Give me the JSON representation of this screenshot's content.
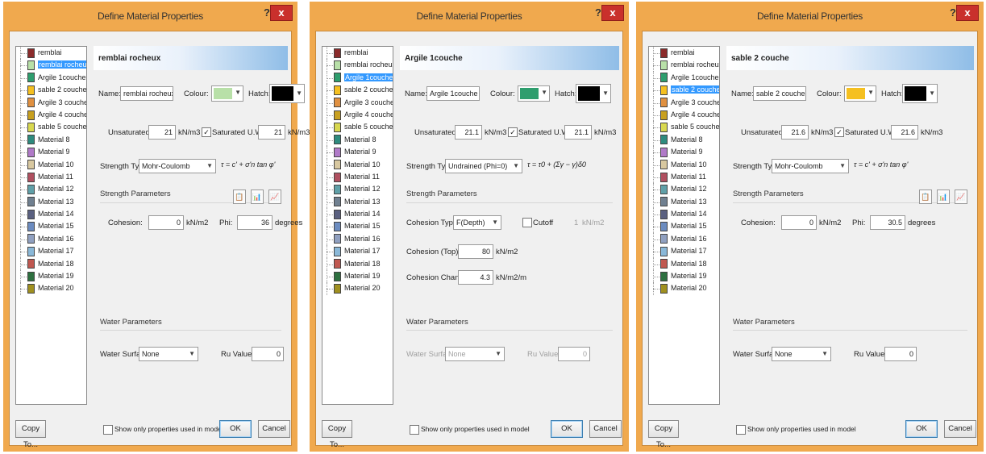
{
  "window": {
    "title": "Define Material Properties",
    "help_label": "?",
    "close_label": "x"
  },
  "materials": [
    "remblai",
    "remblai rocheux",
    "Argile 1couche",
    "sable 2 couche",
    "Argile 3 couche",
    "Argile 4 couche",
    "sable 5 couche",
    "Material 8",
    "Material 9",
    "Material 10",
    "Material 11",
    "Material 12",
    "Material 13",
    "Material 14",
    "Material 15",
    "Material 16",
    "Material 17",
    "Material 18",
    "Material 19",
    "Material 20"
  ],
  "swatch_colors": [
    "#8b2b2b",
    "#b8e0a8",
    "#2e9e6e",
    "#f5c020",
    "#e09040",
    "#c8a020",
    "#d8d850",
    "#2e8b7e",
    "#b07ac8",
    "#d8c8a0",
    "#b05060",
    "#60a0a8",
    "#708090",
    "#5a6080",
    "#6c8cc0",
    "#90a0c0",
    "#8ab8d8",
    "#c05850",
    "#2e7040",
    "#a09020"
  ],
  "labels": {
    "name": "Name:",
    "colour": "Colour:",
    "hatch": "Hatch:",
    "unsaturated": "Unsaturated",
    "saturated": "Saturated U.W.",
    "unit_weight": "kN/m3",
    "strength_type": "Strength Type:",
    "strength_parameters": "Strength Parameters",
    "cohesion": "Cohesion:",
    "phi": "Phi:",
    "degrees": "degrees",
    "kpa": "kN/m2",
    "water_parameters": "Water Parameters",
    "water_surface": "Water Surface:",
    "ru_value": "Ru Value:",
    "cohesion_type": "Cohesion Type:",
    "cutoff": "Cutoff",
    "cohesion_top": "Cohesion (Top):",
    "cohesion_change": "Cohesion Change:",
    "kpa_per_m": "kN/m2/m",
    "copy_to": "Copy To...",
    "show_only": "Show only properties used in model",
    "ok": "OK",
    "cancel": "Cancel",
    "mc_formula": "τ = c' + σ'n tan φ'",
    "und_formula": "τ = τ0 + (Σγ − γ)δ0"
  },
  "dialogs": [
    {
      "selected_index": 1,
      "heading": "remblai rocheux",
      "name": "remblai rocheux",
      "colour": "#b8e0a8",
      "unsaturated": "21",
      "saturated": "21",
      "strength_type": "Mohr-Coulomb",
      "cohesion": "0",
      "phi": "36",
      "water_surface": "None",
      "ru_value": "0"
    },
    {
      "selected_index": 2,
      "heading": "Argile 1couche",
      "name": "Argile 1couche",
      "colour": "#2e9e6e",
      "unsaturated": "21.1",
      "saturated": "21.1",
      "strength_type": "Undrained (Phi=0)",
      "cohesion_type": "F(Depth)",
      "cutoff_value": "1",
      "cohesion_top": "80",
      "cohesion_change": "4.3",
      "water_surface": "None",
      "ru_value": "0"
    },
    {
      "selected_index": 3,
      "heading": "sable 2 couche",
      "name": "sable 2 couche",
      "colour": "#f5c020",
      "unsaturated": "21.6",
      "saturated": "21.6",
      "strength_type": "Mohr-Coulomb",
      "cohesion": "0",
      "phi": "30.5",
      "water_surface": "None",
      "ru_value": "0"
    }
  ]
}
